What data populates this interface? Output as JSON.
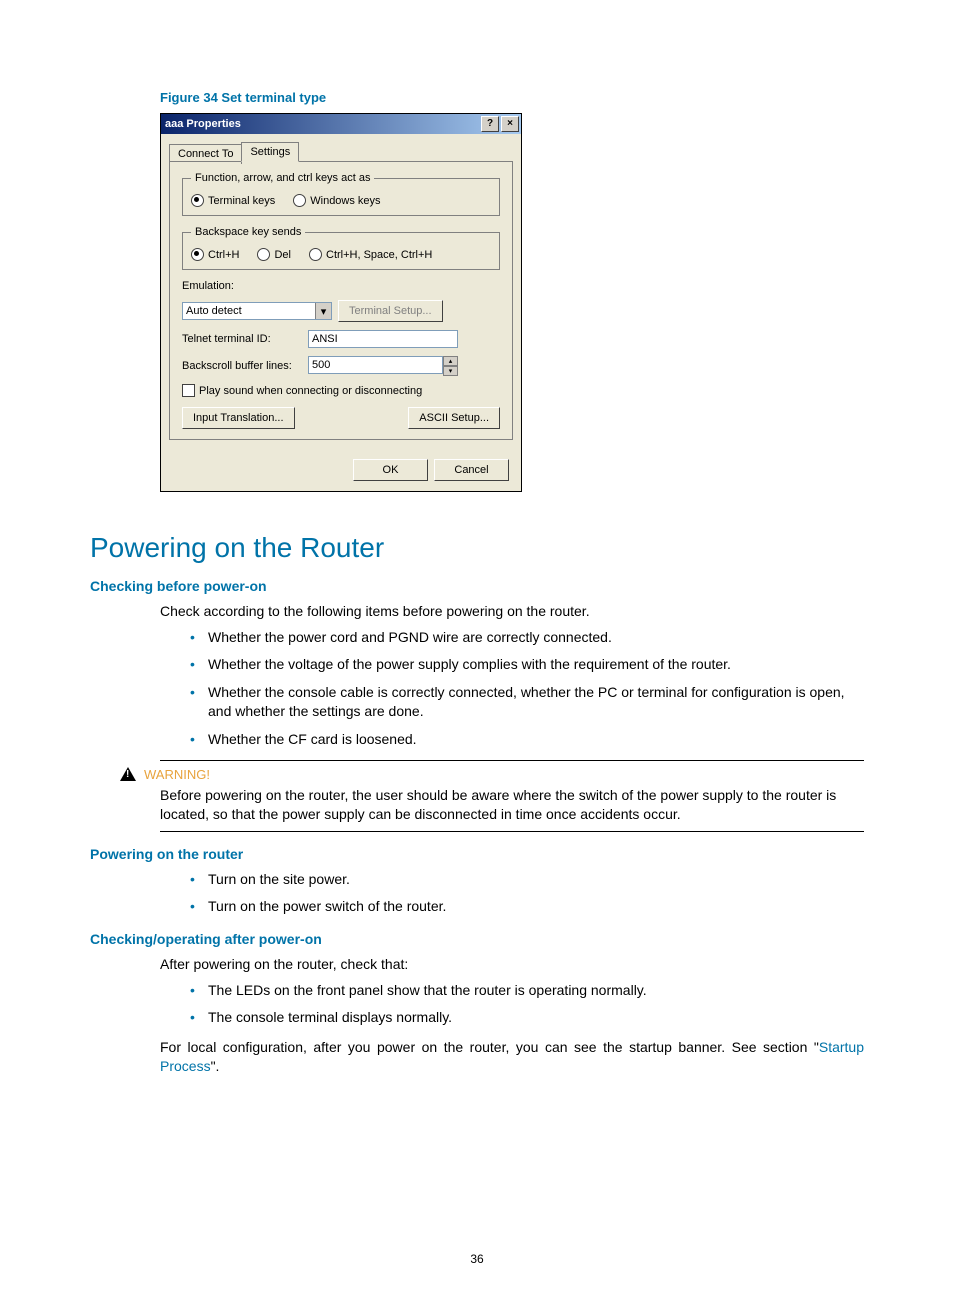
{
  "figure_caption": "Figure 34 Set terminal type",
  "dialog": {
    "title": "aaa Properties",
    "help_btn": "?",
    "close_btn": "×",
    "tabs": {
      "connect": "Connect To",
      "settings": "Settings"
    },
    "group1": {
      "legend": "Function, arrow, and ctrl keys act as",
      "opt_terminal": "Terminal keys",
      "opt_windows": "Windows keys"
    },
    "group2": {
      "legend": "Backspace key sends",
      "opt1": "Ctrl+H",
      "opt2": "Del",
      "opt3": "Ctrl+H, Space, Ctrl+H"
    },
    "emulation_label": "Emulation:",
    "emulation_value": "Auto detect",
    "terminal_setup_btn": "Terminal Setup...",
    "telnet_id_label": "Telnet terminal ID:",
    "telnet_id_value": "ANSI",
    "backscroll_label": "Backscroll buffer lines:",
    "backscroll_value": "500",
    "play_sound": "Play sound when connecting or disconnecting",
    "input_translation_btn": "Input Translation...",
    "ascii_setup_btn": "ASCII Setup...",
    "ok_btn": "OK",
    "cancel_btn": "Cancel"
  },
  "section_title": "Powering on the Router",
  "sub1": "Checking before power-on",
  "intro1": "Check according to the following items before powering on the router.",
  "bul1": [
    "Whether the power cord and PGND wire are correctly connected.",
    "Whether the voltage of the power supply complies with the requirement of the router.",
    "Whether the console cable is correctly connected, whether the PC or terminal for configuration is open, and whether the settings are done.",
    "Whether the CF card is loosened."
  ],
  "warning_label": "WARNING!",
  "warning_text": "Before powering on the router, the user should be aware where the switch of the power supply to the router is located, so that the power supply can be disconnected in time once accidents occur.",
  "sub2": "Powering on the router",
  "bul2": [
    "Turn on the site power.",
    "Turn on the power switch of the router."
  ],
  "sub3": "Checking/operating after power-on",
  "intro3": "After powering on the router, check that:",
  "bul3": [
    "The LEDs on the front panel show that the router is operating normally.",
    "The console terminal displays normally."
  ],
  "para_local_pre": "For local configuration, after you power on the router, you can see the startup banner. See section \"",
  "para_local_link": "Startup Process",
  "para_local_post": "\".",
  "page_number": "36"
}
